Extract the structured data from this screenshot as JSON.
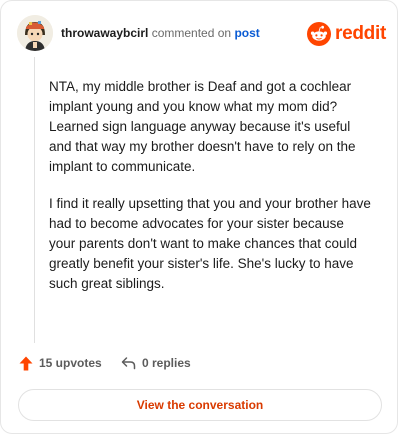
{
  "header": {
    "username": "throwawaybcirl",
    "commented_on": "commented on",
    "post_link": "post",
    "brand": "reddit"
  },
  "comment": {
    "paragraphs": [
      "NTA, my middle brother is Deaf and got a cochlear implant young and you know what my mom did? Learned sign language anyway because it's useful and that way my brother doesn't have to rely on the implant to communicate.",
      "I find it really upsetting that you and your brother have had to become advocates for your sister because your parents don't want to make chances that could greatly benefit your sister's life. She's lucky to have such great siblings."
    ]
  },
  "actions": {
    "upvotes": "15 upvotes",
    "replies": "0 replies"
  },
  "footer": {
    "view_button": "View the conversation"
  },
  "colors": {
    "brand": "#ff4500",
    "link": "#0a5bd3",
    "button_text": "#d93a00"
  },
  "icons": {
    "upvote": "upvote-arrow-icon",
    "reply": "reply-arrow-icon",
    "logo": "reddit-snoo-icon"
  }
}
